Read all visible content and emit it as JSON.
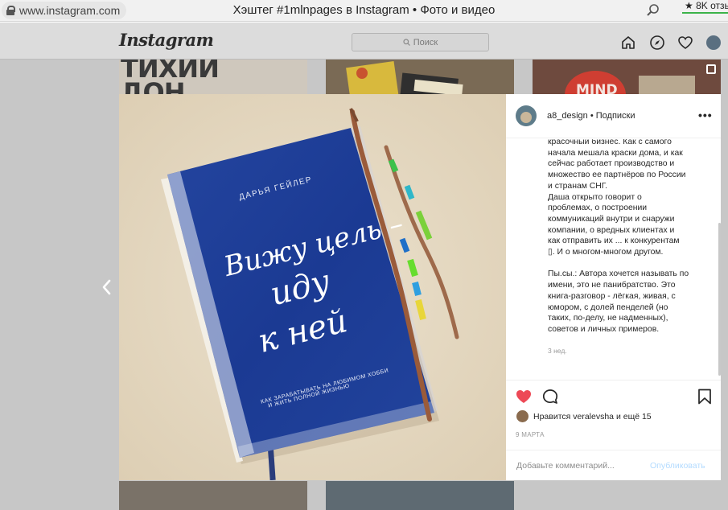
{
  "browser": {
    "url": "www.instagram.com",
    "title": "Хэштег #1mlnpages в Instagram • Фото и видео",
    "reviews": "★ 8K отзы"
  },
  "instagram": {
    "logo": "Instagram",
    "search_placeholder": "Поиск"
  },
  "post": {
    "username": "a8_design",
    "separator": " • ",
    "follow_label": "Подписки",
    "more_label": "•••",
    "caption_lines": [
      "красочный бизнес. Как с самого",
      "начала мешала краски дома, и как",
      "сейчас работает производство и",
      "множество ее партнёров по России",
      "и странам СНГ.",
      "Даша открыто говорит о",
      "проблемах, о построении",
      "коммуникаций внутри и снаружи",
      "компании, о вредных клиентах и",
      "как отправить их ... к конкурентам",
      "▯. И о многом-многом другом.",
      "",
      "Пы.сы.: Автора хочется называть по",
      "имени, это не панибратство. Это",
      "книга-разговор - лёгкая, живая, с",
      "юмором, с долей пенделей (но",
      "таких, по-делу, не надменных),",
      "советов и личных примеров."
    ],
    "caption_date": "3 нед.",
    "likes_text": "Нравится veralevsha и ещё 15",
    "post_date": "9 МАРТА",
    "comment_placeholder": "Добавьте комментарий...",
    "publish_label": "Опубликовать"
  },
  "book": {
    "author": "ДАРЬЯ ГЕЙЛЕР",
    "title_line1": "Вижу цель –",
    "title_line2": "иду",
    "title_line3": "к ней",
    "subtitle_line1": "КАК ЗАРАБАТЫВАТЬ НА ЛЮБИМОМ ХОББИ",
    "subtitle_line2": "И ЖИТЬ ПОЛНОЙ ЖИЗНЬЮ"
  },
  "colors": {
    "heart": "#ed4956",
    "publish": "#b3dbff",
    "book_blue": "#1d3f9e"
  }
}
